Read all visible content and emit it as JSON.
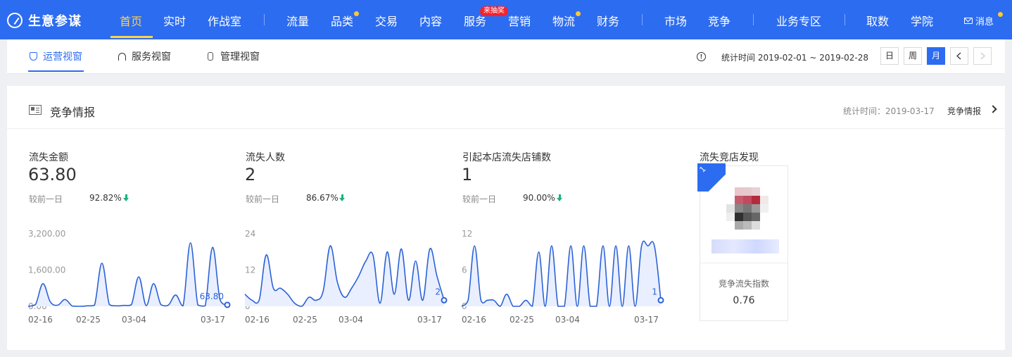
{
  "app": {
    "name": "生意参谋"
  },
  "nav": {
    "items": [
      {
        "label": "首页",
        "active": true
      },
      {
        "label": "实时"
      },
      {
        "label": "作战室"
      },
      {
        "label": "流量"
      },
      {
        "label": "品类",
        "dot": true
      },
      {
        "label": "交易"
      },
      {
        "label": "内容"
      },
      {
        "label": "服务",
        "badge": "来抽奖"
      },
      {
        "label": "营销"
      },
      {
        "label": "物流",
        "dot": true
      },
      {
        "label": "财务"
      },
      {
        "label": "市场"
      },
      {
        "label": "竞争"
      },
      {
        "label": "业务专区"
      },
      {
        "label": "取数"
      },
      {
        "label": "学院"
      }
    ],
    "message_label": "消息"
  },
  "subtabs": [
    {
      "label": "运营视窗",
      "icon": "shield-icon",
      "active": true
    },
    {
      "label": "服务视窗",
      "icon": "headset-icon"
    },
    {
      "label": "管理视窗",
      "icon": "hourglass-icon"
    }
  ],
  "period": {
    "stat_time": "统计时间 2019-02-01 ~ 2019-02-28",
    "buttons": [
      "日",
      "周",
      "月"
    ],
    "active": "月"
  },
  "card": {
    "title": "竞争情报",
    "stat_time": "统计时间：2019-03-17",
    "link": "竞争情报"
  },
  "metrics": [
    {
      "label": "流失金额",
      "value": "63.80",
      "cmp_label": "较前一日",
      "cmp_value": "92.82%",
      "trend": "down"
    },
    {
      "label": "流失人数",
      "value": "2",
      "cmp_label": "较前一日",
      "cmp_value": "86.67%",
      "trend": "down"
    },
    {
      "label": "引起本店流失店铺数",
      "value": "1",
      "cmp_label": "较前一日",
      "cmp_value": "90.00%",
      "trend": "down"
    }
  ],
  "chart_data": [
    {
      "type": "area",
      "ylim": [
        0,
        3200
      ],
      "yticks": [
        "3,200.00",
        "1,600.00",
        "0.00"
      ],
      "x_labels": [
        "02-16",
        "02-25",
        "03-04",
        "03-17"
      ],
      "values": [
        0,
        80,
        1000,
        200,
        50,
        300,
        10,
        0,
        20,
        50,
        1900,
        80,
        20,
        40,
        70,
        1300,
        30,
        1000,
        70,
        50,
        500,
        20,
        2800,
        60,
        20,
        2600,
        300,
        64
      ],
      "end_label": "63.80",
      "color": "#2c62d6"
    },
    {
      "type": "area",
      "ylim": [
        0,
        24
      ],
      "yticks": [
        "24",
        "12",
        "0"
      ],
      "x_labels": [
        "02-16",
        "02-25",
        "03-04",
        "03-17"
      ],
      "values": [
        4,
        2,
        2,
        17,
        6,
        6,
        4,
        1,
        0,
        3,
        2,
        5,
        20,
        8,
        3,
        6,
        10,
        15,
        17,
        1,
        18,
        4,
        19,
        2,
        15,
        2,
        19,
        10,
        2
      ],
      "end_label": "2",
      "color": "#2c62d6"
    },
    {
      "type": "area",
      "ylim": [
        0,
        12
      ],
      "yticks": [
        "12",
        "6",
        "0"
      ],
      "x_labels": [
        "02-16",
        "02-25",
        "03-04",
        "03-17"
      ],
      "values": [
        0,
        1,
        10,
        1,
        1,
        1,
        0,
        2,
        0,
        0,
        1,
        0,
        9,
        0,
        10,
        0,
        0,
        10,
        0,
        10,
        0,
        0,
        10,
        0,
        10,
        0,
        10,
        0,
        10,
        10,
        10,
        1
      ],
      "end_label": "1",
      "color": "#2c62d6"
    }
  ],
  "competitor": {
    "title": "流失竞店发现",
    "rank": "1",
    "index_label": "竞争流失指数",
    "index_value": "0.76"
  }
}
